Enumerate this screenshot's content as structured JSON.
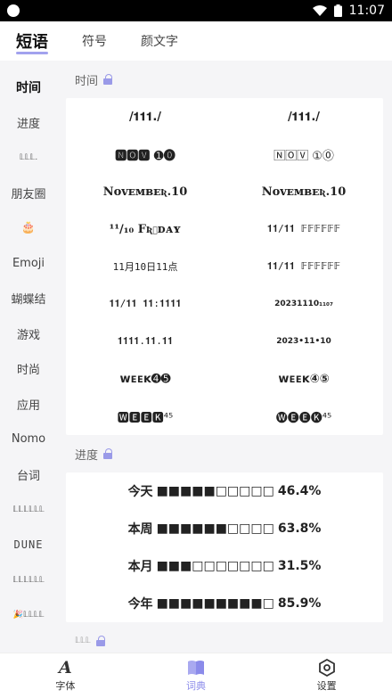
{
  "status": {
    "time": "11:07"
  },
  "top_tabs": [
    "短语",
    "符号",
    "颜文字"
  ],
  "sidebar": [
    "时间",
    "进度",
    "𝕃𝕃𝕃.",
    "朋友圈",
    "🎂",
    "Emoji",
    "蝴蝶结",
    "游戏",
    "时尚",
    "应用",
    "Nomo",
    "台词",
    "𝕃𝕃𝕃𝕃𝕃𝕃",
    "DUNE",
    "𝕃𝕃𝕃𝕃𝕃𝕃",
    "🎉𝕃𝕃𝕃𝕃"
  ],
  "sections": {
    "time": {
      "title": "时间",
      "rows": [
        [
          "/𝟏𝟏𝟏./",
          "/𝟏𝟏𝟏./"
        ],
        [
          "🅽🅾🆅 ➊⓿",
          "🄽🄾🅅 ①⓪"
        ],
        [
          "Nᴏᴠᴇᴍʙᴇʀ.𝟏0",
          "Nᴏᴠᴇᴍʙᴇʀ.10"
        ],
        [
          "¹¹/₁₀ Fʀɪᴅᴀʏ",
          "𝟏𝟏/𝟏𝟏 𝔽𝔽𝔽𝔽𝔽𝔽"
        ],
        [
          "11月10日11点",
          "𝟏𝟏/𝟏𝟏 𝔽𝔽𝔽𝔽𝔽𝔽"
        ],
        [
          "𝟏𝟏/𝟏𝟏 𝟏𝟏:𝟏𝟏𝟏𝟏",
          "20231110₁₁₀₇"
        ],
        [
          "𝟏𝟏𝟏𝟏.𝟏𝟏.𝟏𝟏",
          "2023•11•10"
        ],
        [
          "ᴡᴇᴇᴋ➍➎",
          "ᴡᴇᴇᴋ④⑤"
        ],
        [
          "🆆🅴🅴🅺⁴⁵",
          "🅦🅔🅔🅚⁴⁵"
        ]
      ]
    },
    "progress": {
      "title": "进度",
      "rows": [
        {
          "label": "今天",
          "bar": "■■■■■□□□□□",
          "value": "46.4%"
        },
        {
          "label": "本周",
          "bar": "■■■■■■□□□□",
          "value": "63.8%"
        },
        {
          "label": "本月",
          "bar": "■■■□□□□□□□",
          "value": "31.5%"
        },
        {
          "label": "今年",
          "bar": "■■■■■■■■■□",
          "value": "85.9%"
        }
      ]
    },
    "next": {
      "title": "𝕃𝕃𝕃"
    }
  },
  "bottom_nav": [
    "字体",
    "词典",
    "设置"
  ],
  "colors": {
    "accent": "#8b8bea"
  }
}
